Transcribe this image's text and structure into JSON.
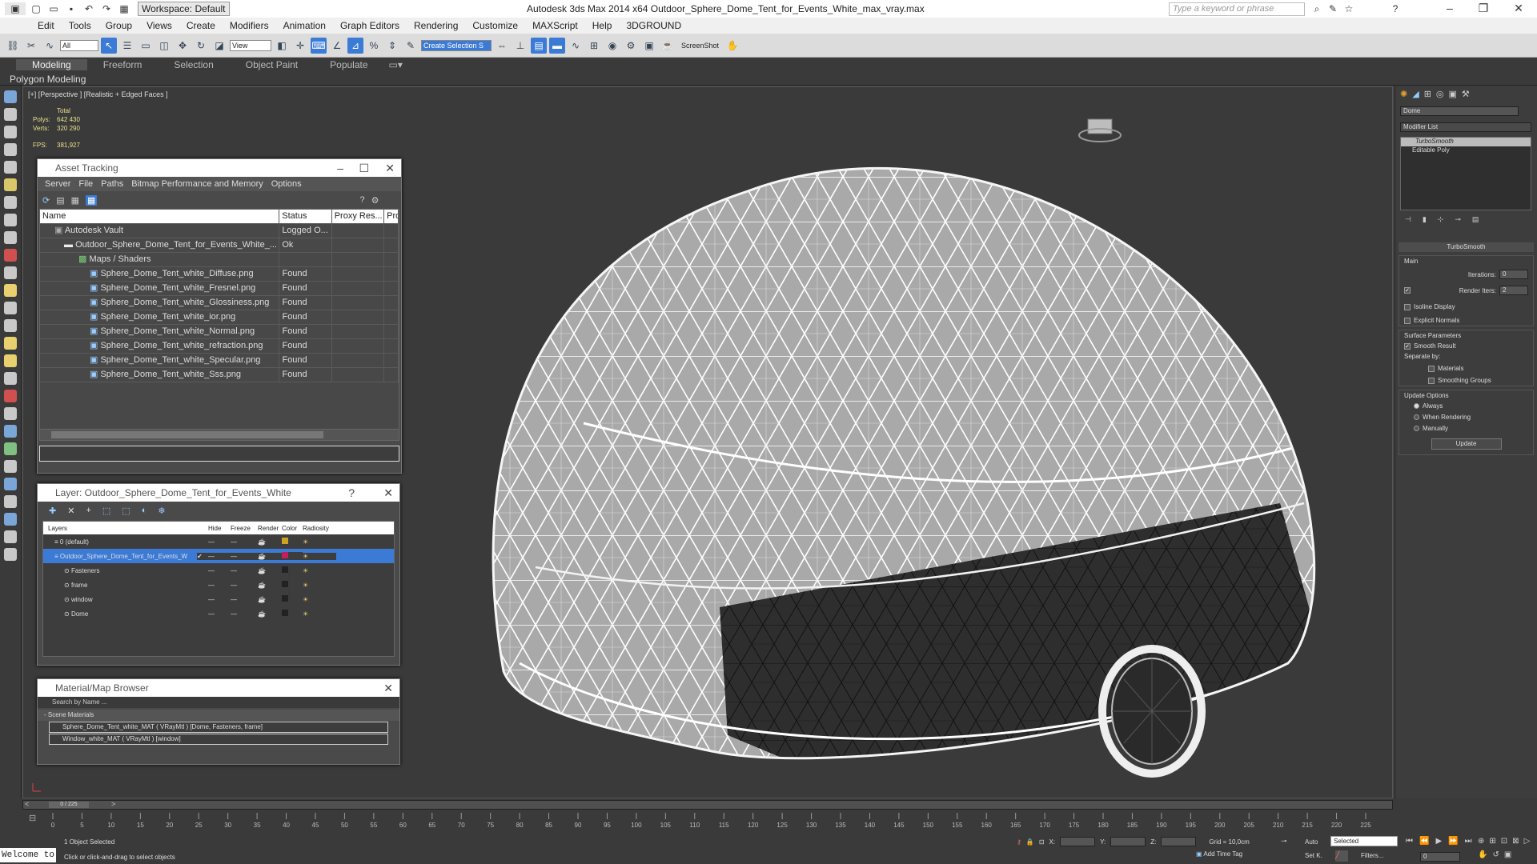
{
  "window": {
    "title": "Autodesk 3ds Max  2014 x64     Outdoor_Sphere_Dome_Tent_for_Events_White_max_vray.max",
    "workspace": "Workspace: Default",
    "search_placeholder": "Type a keyword or phrase"
  },
  "menu": [
    "Edit",
    "Tools",
    "Group",
    "Views",
    "Create",
    "Modifiers",
    "Animation",
    "Graph Editors",
    "Rendering",
    "Customize",
    "MAXScript",
    "Help",
    "3DGROUND"
  ],
  "toolbar": {
    "filter_value": "All",
    "view_value": "View",
    "selection_set": "Create Selection S",
    "screenshot_label": "ScreenShot"
  },
  "ribbon": {
    "tabs": [
      "Modeling",
      "Freeform",
      "Selection",
      "Object Paint",
      "Populate"
    ],
    "active_tab": "Modeling",
    "sub_label": "Polygon Modeling"
  },
  "viewport": {
    "label": "[+] [Perspective ] [Realistic + Edged Faces ]",
    "stats": {
      "total_label": "Total",
      "polys_label": "Polys:",
      "polys": "642 430",
      "verts_label": "Verts:",
      "verts": "320 290",
      "fps_label": "FPS:",
      "fps": "381,927"
    }
  },
  "asset_tracking": {
    "title": "Asset Tracking",
    "menu": [
      "Server",
      "File",
      "Paths",
      "Bitmap Performance and Memory",
      "Options"
    ],
    "columns": [
      "Name",
      "Status",
      "Proxy Res...",
      "Pro"
    ],
    "rows": [
      {
        "name": "Autodesk Vault",
        "status": "Logged O..."
      },
      {
        "name": "Outdoor_Sphere_Dome_Tent_for_Events_White_...",
        "status": "Ok"
      },
      {
        "name": "Maps / Shaders",
        "status": ""
      },
      {
        "name": "Sphere_Dome_Tent_white_Diffuse.png",
        "status": "Found"
      },
      {
        "name": "Sphere_Dome_Tent_white_Fresnel.png",
        "status": "Found"
      },
      {
        "name": "Sphere_Dome_Tent_white_Glossiness.png",
        "status": "Found"
      },
      {
        "name": "Sphere_Dome_Tent_white_ior.png",
        "status": "Found"
      },
      {
        "name": "Sphere_Dome_Tent_white_Normal.png",
        "status": "Found"
      },
      {
        "name": "Sphere_Dome_Tent_white_refraction.png",
        "status": "Found"
      },
      {
        "name": "Sphere_Dome_Tent_white_Specular.png",
        "status": "Found"
      },
      {
        "name": "Sphere_Dome_Tent_white_Sss.png",
        "status": "Found"
      }
    ]
  },
  "layer": {
    "title": "Layer: Outdoor_Sphere_Dome_Tent_for_Events_White",
    "help": "?",
    "columns": [
      "Layers",
      "Hide",
      "Freeze",
      "Render",
      "Color",
      "Radiosity"
    ],
    "rows": [
      {
        "name": "0 (default)",
        "color": "#d0a020"
      },
      {
        "name": "Outdoor_Sphere_Dome_Tent_for_Events_W",
        "color": "#c02060"
      },
      {
        "name": "Fasteners",
        "color": "#222222"
      },
      {
        "name": "frame",
        "color": "#222222"
      },
      {
        "name": "window",
        "color": "#222222"
      },
      {
        "name": "Dome",
        "color": "#222222"
      }
    ]
  },
  "material_browser": {
    "title": "Material/Map Browser",
    "search": "Search by Name ...",
    "group": "- Scene Materials",
    "items": [
      "Sphere_Dome_Tent_white_MAT ( VRayMtl ) [Dome, Fasteners, frame]",
      "Window_white_MAT ( VRayMtl ) [window]"
    ]
  },
  "command_panel": {
    "object_name": "Dome",
    "modifier_list": "Modifier List",
    "stack": [
      "TurboSmooth",
      "Editable Poly"
    ],
    "rollout": "TurboSmooth",
    "main": "Main",
    "iterations_label": "Iterations:",
    "iterations": "0",
    "render_iters_label": "Render Iters:",
    "render_iters": "2",
    "isoline": "Isoline Display",
    "explicit": "Explicit Normals",
    "surface": "Surface Parameters",
    "smooth_result": "Smooth Result",
    "separate_by": "Separate by:",
    "materials": "Materials",
    "smoothing_groups": "Smoothing Groups",
    "update_options": "Update Options",
    "always": "Always",
    "when_rendering": "When Rendering",
    "manually": "Manually",
    "update": "Update"
  },
  "timeline": {
    "frame": "0 / 225",
    "ticks": [
      "0",
      "5",
      "10",
      "15",
      "20",
      "25",
      "30",
      "35",
      "40",
      "45",
      "50",
      "55",
      "60",
      "65",
      "70",
      "75",
      "80",
      "85",
      "90",
      "95",
      "100",
      "105",
      "110",
      "115",
      "120",
      "125",
      "130",
      "135",
      "140",
      "145",
      "150",
      "155",
      "160",
      "165",
      "170",
      "175",
      "180",
      "185",
      "190",
      "195",
      "200",
      "205",
      "210",
      "215",
      "220",
      "225"
    ]
  },
  "status": {
    "selected": "1 Object Selected",
    "hint": "Click or click-and-drag to select objects",
    "welcome": "Welcome to",
    "x_label": "X:",
    "y_label": "Y:",
    "z_label": "Z:",
    "grid": "Grid = 10,0cm",
    "auto": "Auto",
    "selected_dropdown": "Selected",
    "set_key": "Set K.",
    "filters": "Filters...",
    "add_time_tag": "Add Time Tag",
    "frame_field": "0"
  }
}
